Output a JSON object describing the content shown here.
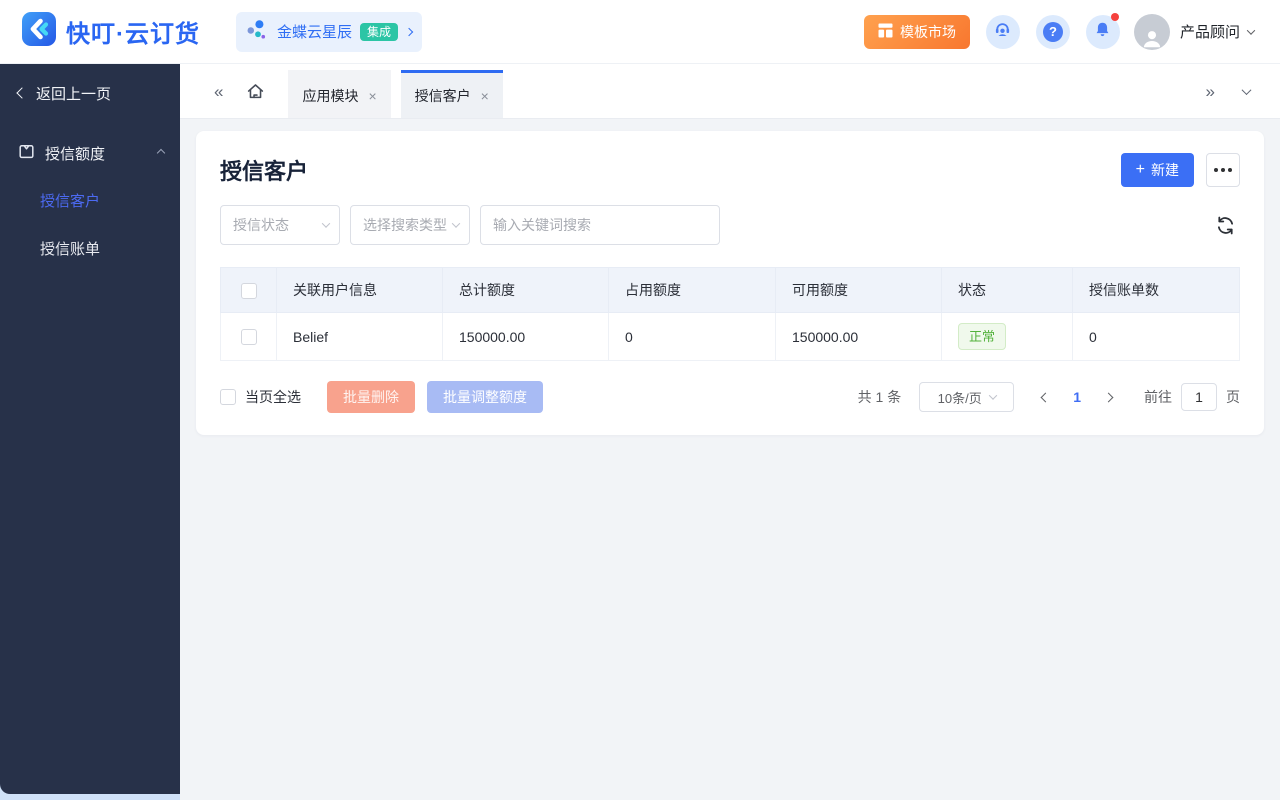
{
  "colors": {
    "primary": "#3b6ff5",
    "brand_blue": "#2a66f2",
    "market_orange_start": "#ffa14e",
    "market_orange_end": "#f8772f",
    "integration_badge_teal": "#2cc5a5",
    "status_success_text": "#53b23c",
    "danger_disabled": "#f8a28d",
    "primary_disabled": "#a8bbf4",
    "sidebar_bg": "#273149",
    "notification_dot": "#f5413d",
    "active_tab_bar": "#2e6bf2"
  },
  "brand": {
    "logo_text": "快叮·云订货",
    "integration_name": "金蝶云星辰",
    "integration_badge": "集成"
  },
  "header": {
    "template_market": "模板市场",
    "user_role": "产品顾问"
  },
  "icons": {
    "collapse_left": "«",
    "collapse_right": "»",
    "tab_close": "×",
    "plus": "+",
    "question": "?"
  },
  "sidebar": {
    "back": "返回上一页",
    "group": "授信额度",
    "items": [
      {
        "label": "授信客户",
        "active": true
      },
      {
        "label": "授信账单",
        "active": false
      }
    ]
  },
  "tabs": [
    {
      "label": "应用模块",
      "active": false
    },
    {
      "label": "授信客户",
      "active": true
    }
  ],
  "page": {
    "title": "授信客户",
    "new_button": "新建",
    "filters": {
      "status": "授信状态",
      "type": "选择搜索类型",
      "keyword": "输入关键词搜索"
    },
    "table": {
      "columns": [
        "关联用户信息",
        "总计额度",
        "占用额度",
        "可用额度",
        "状态",
        "授信账单数"
      ],
      "rows": [
        {
          "user": "Belief",
          "total": "150000.00",
          "used": "0",
          "available": "150000.00",
          "status": "正常",
          "bills": "0"
        }
      ]
    },
    "footer": {
      "select_all": "当页全选",
      "batch_delete": "批量删除",
      "batch_adjust": "批量调整额度",
      "total": "共 1 条",
      "page_size": "10条/页",
      "current_page": "1",
      "goto_prefix": "前往",
      "goto_value": "1",
      "goto_suffix": "页"
    }
  }
}
